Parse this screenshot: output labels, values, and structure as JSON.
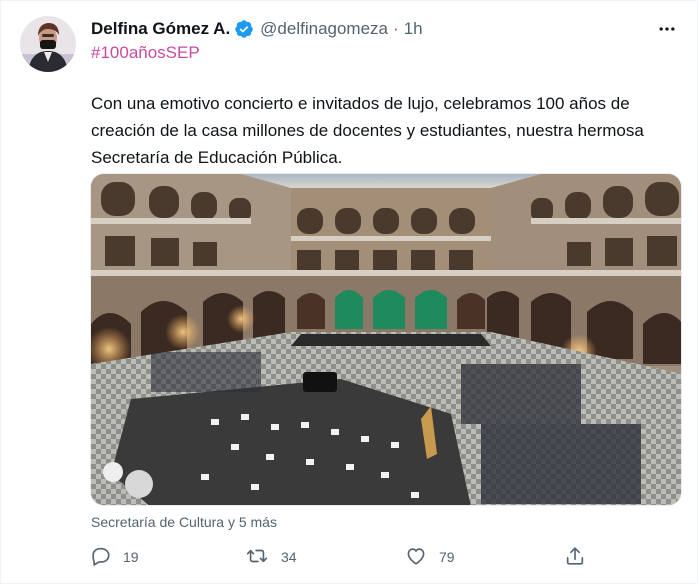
{
  "tweet": {
    "author_name": "Delfina Gómez A.",
    "handle": "@delfinagomeza",
    "separator": "·",
    "time": "1h",
    "hashtag": "#100añosSEP",
    "text": "Con una emotivo concierto e invitados de lujo, celebramos 100 años de creación de la casa millones de docentes y estudiantes, nuestra hermosa Secretaría de Educación Pública.",
    "tagged": "Secretaría de Cultura y 5 más",
    "replies": "19",
    "retweets": "34",
    "likes": "79"
  },
  "icons": {
    "verified": "verified-badge-icon",
    "more": "more-options-icon",
    "reply": "reply-icon",
    "retweet": "retweet-icon",
    "like": "heart-icon",
    "share": "share-icon"
  },
  "colors": {
    "hashtag": "#c94ba0",
    "verified": "#1d9bf0",
    "secondary_text": "#536471"
  }
}
